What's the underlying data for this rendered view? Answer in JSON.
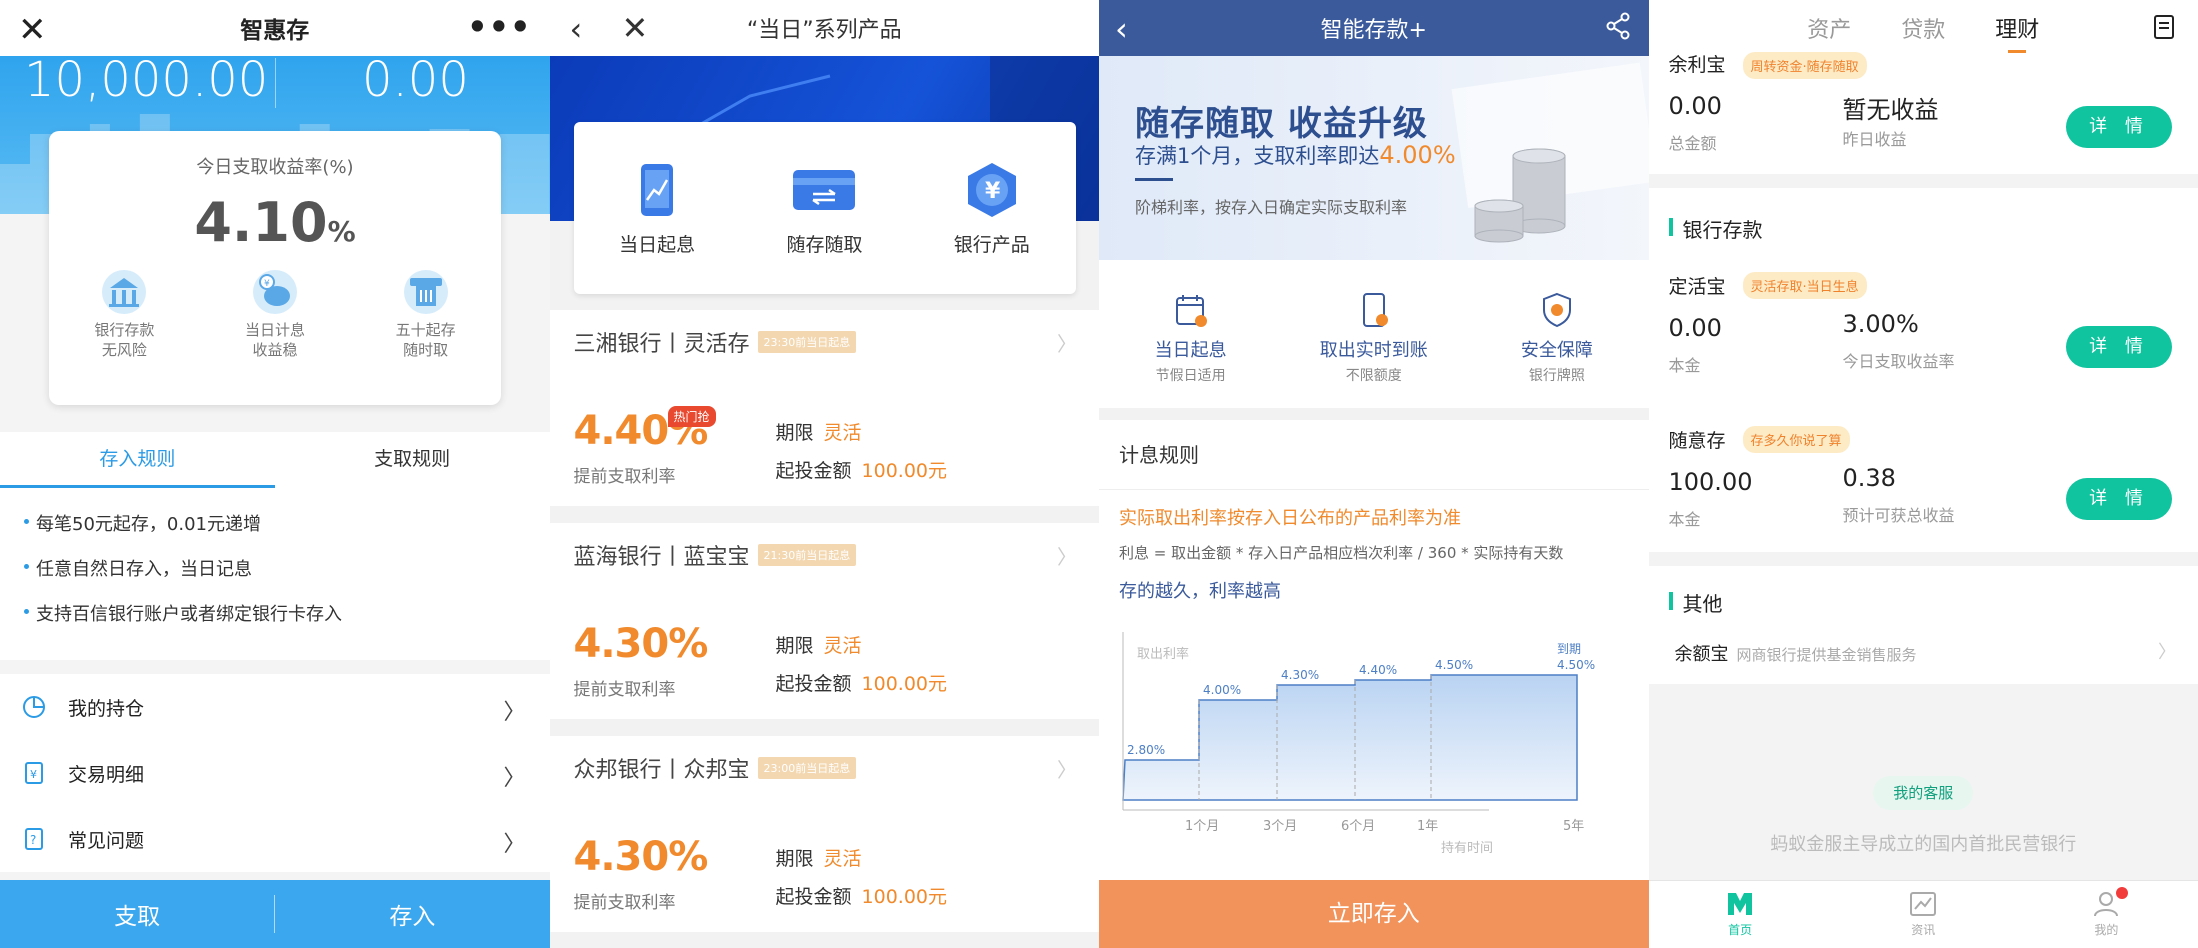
{
  "p1": {
    "title": "智惠存",
    "amount_left": "10,000.00",
    "amount_right": "0.00",
    "rate_label": "今日支取收益率(%)",
    "rate_value": "4.10",
    "rate_unit": "%",
    "features": [
      {
        "l1": "银行存款",
        "l2": "无风险"
      },
      {
        "l1": "当日计息",
        "l2": "收益稳"
      },
      {
        "l1": "五十起存",
        "l2": "随时取"
      }
    ],
    "tabs": [
      "存入规则",
      "支取规则"
    ],
    "rules": [
      "每笔50元起存，0.01元递增",
      "任意自然日存入，当日记息",
      "支持百信银行账户或者绑定银行卡存入"
    ],
    "menu": [
      "我的持仓",
      "交易明细",
      "常见问题"
    ],
    "bottom": [
      "支取",
      "存入"
    ],
    "accent": "#2c9be6"
  },
  "p2": {
    "title": "“当日”系列产品",
    "categories": [
      "当日起息",
      "随存随取",
      "银行产品"
    ],
    "products": [
      {
        "name": "三湘银行丨灵活存",
        "tag": "23:30前当日起息",
        "rate": "4.40%",
        "hot": "热门抢",
        "rate_label": "提前支取利率",
        "term_label": "期限",
        "term": "灵活",
        "min_label": "起投金额",
        "min": "100.00元"
      },
      {
        "name": "蓝海银行丨蓝宝宝",
        "tag": "21:30前当日起息",
        "rate": "4.30%",
        "hot": "",
        "rate_label": "提前支取利率",
        "term_label": "期限",
        "term": "灵活",
        "min_label": "起投金额",
        "min": "100.00元"
      },
      {
        "name": "众邦银行丨众邦宝",
        "tag": "23:00前当日起息",
        "rate": "4.30%",
        "hot": "",
        "rate_label": "提前支取利率",
        "term_label": "期限",
        "term": "灵活",
        "min_label": "起投金额",
        "min": "100.00元"
      }
    ],
    "accent": "#f08a2c"
  },
  "p3": {
    "title": "智能存款+",
    "banner_headline": "随存随取  收益升级",
    "banner_sub_pre": "存满1个月，支取利率即达",
    "banner_sub_rate": "4.00%",
    "banner_note": "阶梯利率，按存入日确定实际支取利率",
    "features": [
      {
        "a": "当日起息",
        "b": "节假日适用"
      },
      {
        "a": "取出实时到账",
        "b": "不限额度"
      },
      {
        "a": "安全保障",
        "b": "银行牌照"
      }
    ],
    "rules_title": "计息规则",
    "rules_orange": "实际取出利率按存入日公布的产品利率为准",
    "rules_formula": "利息 = 取出金额 * 存入日产品相应档次利率 / 360 * 实际持有天数",
    "rules_motto": "存的越久，利率越高",
    "button": "立即存入",
    "chart_data": {
      "type": "area",
      "ylabel": "取出利率",
      "xlabel": "持有时间",
      "categories": [
        "",
        "1个月",
        "3个月",
        "6个月",
        "1年",
        "5年"
      ],
      "values": [
        2.8,
        4.0,
        4.3,
        4.4,
        4.5,
        4.5
      ],
      "value_labels": [
        "2.80%",
        "4.00%",
        "4.30%",
        "4.40%",
        "4.50%",
        "4.50%"
      ],
      "end_annotation": "到期",
      "step": true,
      "grid": false
    }
  },
  "p4": {
    "tabs": [
      "资产",
      "贷款",
      "理财"
    ],
    "active_tab": "理财",
    "yulibao": {
      "name": "余利宝",
      "pill": "周转资金·随存随取",
      "v1": "0.00",
      "l1": "总金额",
      "v2": "暂无收益",
      "l2": "昨日收益",
      "btn": "详 情"
    },
    "section_bank": "银行存款",
    "dinghuo": {
      "name": "定活宝",
      "pill": "灵活存取·当日生息",
      "v1": "0.00",
      "l1": "本金",
      "v2": "3.00%",
      "l2": "今日支取收益率",
      "btn": "详 情"
    },
    "suiyi": {
      "name": "随意存",
      "pill": "存多久你说了算",
      "v1": "100.00",
      "l1": "本金",
      "v2": "0.38",
      "l2": "预计可获总收益",
      "btn": "详 情"
    },
    "section_other": "其他",
    "yuebao": {
      "name": "余额宝",
      "note": "网商银行提供基金销售服务"
    },
    "service": "我的客服",
    "slogan": "蚂蚁金服主导成立的国内首批民营银行",
    "nav": [
      "首页",
      "资讯",
      "我的"
    ],
    "accent": "#10c4a0"
  }
}
